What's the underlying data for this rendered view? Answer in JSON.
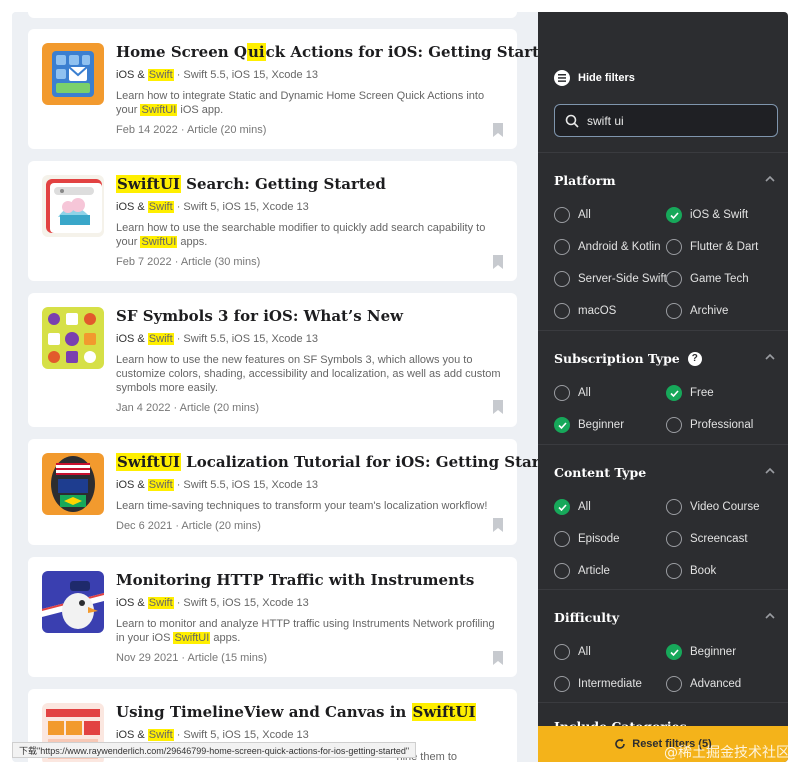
{
  "articles": [
    {
      "title_pre": "Home Screen Q",
      "title_mark": "ui",
      "title_post": "ck Actions for iOS: Getting Started",
      "platform_pre": "iOS & ",
      "platform_mark": "Swift",
      "versions": " · Swift 5.5, iOS 15, Xcode 13",
      "desc_pre": "Learn how to integrate Static and Dynamic Home Screen Quick Actions into your ",
      "desc_mark": "SwiftUI",
      "desc_post": " iOS app.",
      "date": "Feb 14 2022 · Article (20 mins)"
    },
    {
      "title_pre": "",
      "title_mark": "SwiftUI",
      "title_post": " Search: Getting Started",
      "platform_pre": "iOS & ",
      "platform_mark": "Swift",
      "versions": " · Swift 5, iOS 15, Xcode 13",
      "desc_pre": "Learn how to use the searchable modifier to quickly add search capability to your ",
      "desc_mark": "SwiftUI",
      "desc_post": " apps.",
      "date": "Feb 7 2022 · Article (30 mins)"
    },
    {
      "title_pre": "SF Symbols 3 for iOS: What’s New",
      "title_mark": "",
      "title_post": "",
      "platform_pre": "iOS & ",
      "platform_mark": "Swift",
      "versions": " · Swift 5.5, iOS 15, Xcode 13",
      "desc_pre": "Learn how to use the new features on SF Symbols 3, which allows you to customize colors, shading, accessibility and localization, as well as add custom symbols more easily.",
      "desc_mark": "",
      "desc_post": "",
      "date": "Jan 4 2022 · Article (20 mins)"
    },
    {
      "title_pre": "",
      "title_mark": "SwiftUI",
      "title_post": " Localization Tutorial for iOS: Getting Started",
      "platform_pre": "iOS & ",
      "platform_mark": "Swift",
      "versions": " · Swift 5.5, iOS 15, Xcode 13",
      "desc_pre": "Learn time-saving techniques to transform your team's localization workflow!",
      "desc_mark": "",
      "desc_post": "",
      "date": "Dec 6 2021 · Article (20 mins)"
    },
    {
      "title_pre": "Monitoring HTTP Traffic with Instruments",
      "title_mark": "",
      "title_post": "",
      "platform_pre": "iOS & ",
      "platform_mark": "Swift",
      "versions": " · Swift 5, iOS 15, Xcode 13",
      "desc_pre": "Learn to monitor and analyze HTTP traffic using Instruments Network profiling in your iOS ",
      "desc_mark": "SwiftUI",
      "desc_post": " apps.",
      "date": "Nov 29 2021 · Article (15 mins)"
    },
    {
      "title_pre": "Using TimelineView and Canvas in ",
      "title_mark": "SwiftUI",
      "title_post": "",
      "platform_pre": "iOS & ",
      "platform_mark": "Swift",
      "versions": " · Swift 5, iOS 15, Xcode 13",
      "desc_pre": "",
      "desc_mark": "",
      "desc_post": "hine them to",
      "date": ""
    }
  ],
  "sidebar": {
    "hide_filters": "Hide filters",
    "search_value": "swift ui",
    "platform": {
      "title": "Platform",
      "options": [
        "All",
        "iOS & Swift",
        "Android & Kotlin",
        "Flutter & Dart",
        "Server-Side Swift",
        "Game Tech",
        "macOS",
        "Archive"
      ],
      "checked": [
        false,
        true,
        false,
        false,
        false,
        false,
        false,
        false
      ]
    },
    "subscription": {
      "title": "Subscription Type",
      "help": "?",
      "options": [
        "All",
        "Free",
        "Beginner",
        "Professional"
      ],
      "checked": [
        false,
        true,
        true,
        false
      ]
    },
    "content": {
      "title": "Content Type",
      "options": [
        "All",
        "Video Course",
        "Episode",
        "Screencast",
        "Article",
        "Book"
      ],
      "checked": [
        true,
        false,
        false,
        false,
        false,
        false
      ]
    },
    "difficulty": {
      "title": "Difficulty",
      "options": [
        "All",
        "Beginner",
        "Intermediate",
        "Advanced"
      ],
      "checked": [
        false,
        true,
        false,
        false
      ]
    },
    "include_categories": "Include Categories",
    "reset": "Reset filters (5)"
  },
  "status_url": "下载\"https://www.raywenderlich.com/29646799-home-screen-quick-actions-for-ios-getting-started\"",
  "watermark": "@稀土掘金技术社区",
  "colors": {
    "highlight": "#ffef00",
    "sidebar": "#2c2d30",
    "check": "#17a85a",
    "reset": "#f4b31a"
  }
}
